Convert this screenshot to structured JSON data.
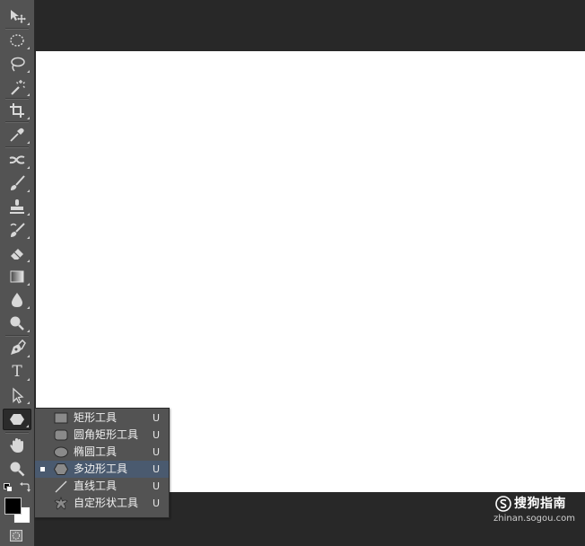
{
  "toolbar": {
    "tools": [
      {
        "name": "move-tool",
        "icon": "move-icon"
      },
      {
        "name": "marquee-tool",
        "icon": "ellipse-marquee-icon"
      },
      {
        "name": "lasso-tool",
        "icon": "lasso-icon"
      },
      {
        "name": "magic-wand-tool",
        "icon": "magic-wand-icon"
      },
      {
        "name": "crop-tool",
        "icon": "crop-icon"
      },
      {
        "name": "eyedropper-tool",
        "icon": "eyedropper-icon"
      },
      {
        "name": "healing-brush-tool",
        "icon": "healing-icon"
      },
      {
        "name": "brush-tool",
        "icon": "brush-icon"
      },
      {
        "name": "clone-stamp-tool",
        "icon": "stamp-icon"
      },
      {
        "name": "history-brush-tool",
        "icon": "history-brush-icon"
      },
      {
        "name": "eraser-tool",
        "icon": "eraser-icon"
      },
      {
        "name": "gradient-tool",
        "icon": "gradient-icon"
      },
      {
        "name": "blur-tool",
        "icon": "drop-icon"
      },
      {
        "name": "dodge-tool",
        "icon": "dodge-icon"
      },
      {
        "name": "pen-tool",
        "icon": "pen-icon"
      },
      {
        "name": "type-tool",
        "icon": "type-icon"
      },
      {
        "name": "path-selection-tool",
        "icon": "arrow-icon"
      },
      {
        "name": "polygon-tool",
        "icon": "polygon-icon"
      },
      {
        "name": "hand-tool",
        "icon": "hand-icon"
      },
      {
        "name": "zoom-tool",
        "icon": "zoom-icon"
      }
    ],
    "type_glyph": "T",
    "foreground_color": "#000000",
    "background_color": "#ffffff"
  },
  "shape_menu": {
    "items": [
      {
        "label": "矩形工具",
        "shortcut": "U",
        "icon": "rectangle-icon",
        "selected": false
      },
      {
        "label": "圆角矩形工具",
        "shortcut": "U",
        "icon": "rounded-rectangle-icon",
        "selected": false
      },
      {
        "label": "椭圆工具",
        "shortcut": "U",
        "icon": "ellipse-icon",
        "selected": false
      },
      {
        "label": "多边形工具",
        "shortcut": "U",
        "icon": "polygon-icon",
        "selected": true
      },
      {
        "label": "直线工具",
        "shortcut": "U",
        "icon": "line-icon",
        "selected": false
      },
      {
        "label": "自定形状工具",
        "shortcut": "U",
        "icon": "custom-shape-icon",
        "selected": false
      }
    ]
  },
  "watermark": {
    "brand": "搜狗指南",
    "url": "zhinan.sogou.com"
  },
  "colors": {
    "workspace": "#282828",
    "toolbar": "#535353",
    "canvas": "#ffffff",
    "menu_highlight": "#4a5a6f"
  }
}
